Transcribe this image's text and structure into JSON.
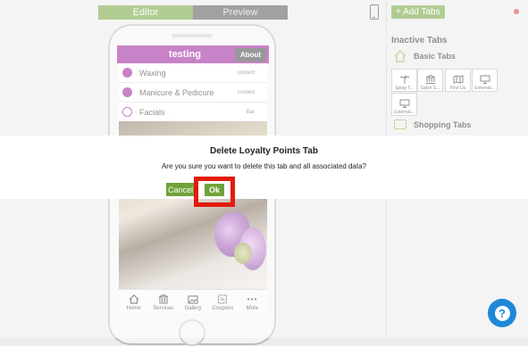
{
  "toggle": {
    "editor": "Editor",
    "preview": "Preview"
  },
  "app": {
    "title": "testing",
    "about": "About",
    "menu": [
      {
        "label": "Waxing",
        "right": "content"
      },
      {
        "label": "Manicure & Pedicure",
        "right": "content"
      },
      {
        "label": "Facials",
        "right": "Bar"
      }
    ],
    "tabbar": [
      "Home",
      "Services",
      "Gallery",
      "Coupons",
      "More"
    ]
  },
  "panel": {
    "add_tabs": "+ Add Tabs",
    "inactive_tabs": "Inactive Tabs",
    "basic_tabs": "Basic Tabs",
    "tiles": [
      "Spray T...",
      "Salon S...",
      "Find Us",
      "External...",
      "External..."
    ],
    "shopping_tabs": "Shopping Tabs"
  },
  "dialog": {
    "title": "Delete Loyalty Points Tab",
    "message": "Are you sure you want to delete this tab and all associated data?",
    "cancel": "Cancel",
    "ok": "Ok"
  },
  "colors": {
    "accent": "#6fa33a",
    "brand_purple": "#9b1d99",
    "highlight": "#e21b0c",
    "help": "#1e88d8"
  }
}
